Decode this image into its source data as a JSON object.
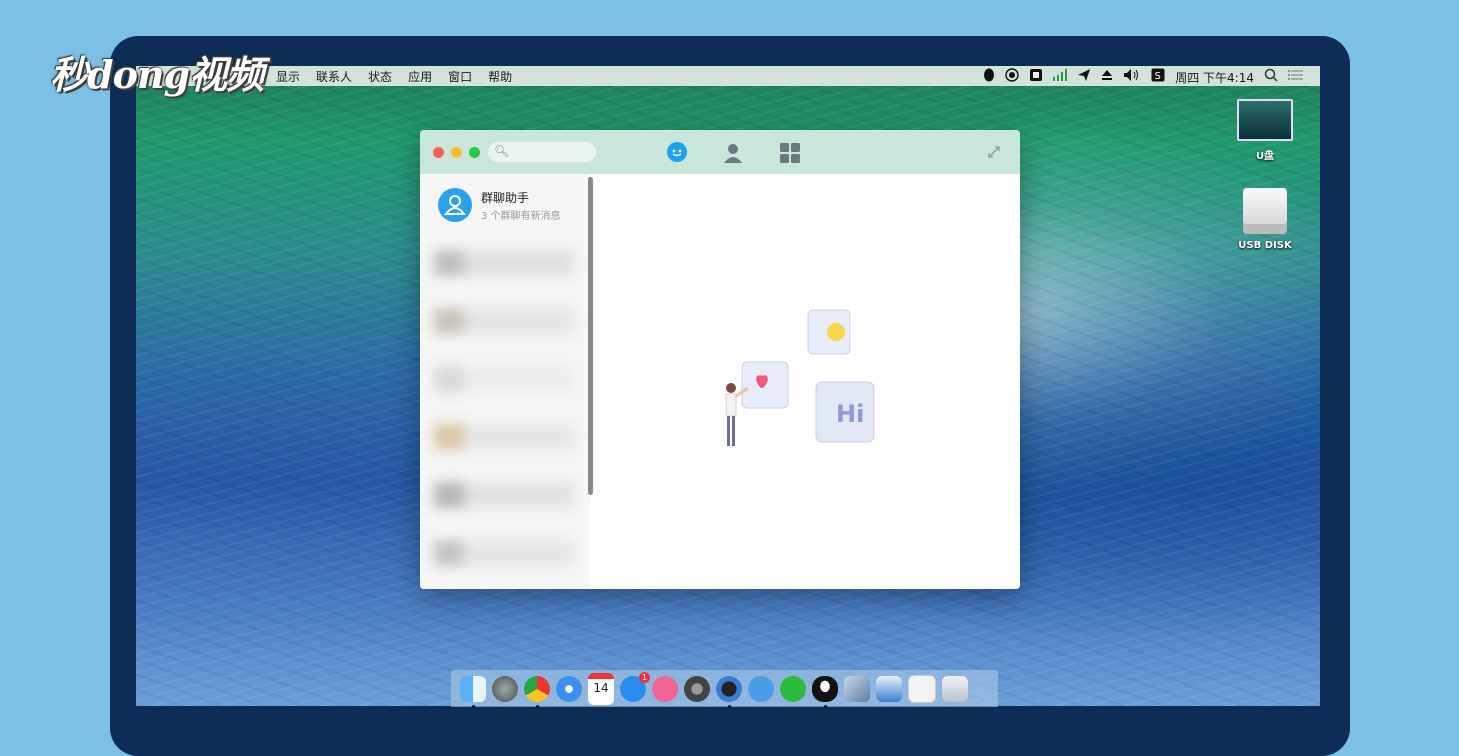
{
  "menubar": {
    "menus": [
      "式",
      "显示",
      "联系人",
      "状态",
      "应用",
      "窗口",
      "帮助"
    ],
    "clock": "周四 下午4:14",
    "status_icons": [
      "qq-penguin-icon",
      "record-icon",
      "input-method-icon",
      "signal-icon",
      "send-icon",
      "eject-icon",
      "volume-icon",
      "sogou-icon",
      "spotlight-search-icon",
      "notification-center-icon"
    ]
  },
  "watermark": {
    "text": "秒dong视频"
  },
  "desktop": {
    "icons": [
      {
        "label": "U盘"
      },
      {
        "label": "USB DISK"
      }
    ]
  },
  "qq_window": {
    "search": {
      "placeholder": ""
    },
    "tabs": [
      "messages-tab",
      "contacts-tab",
      "apps-tab"
    ],
    "conversations": [
      {
        "name": "群聊助手",
        "preview": "3 个群聊有新消息"
      }
    ],
    "illustration_text": "Hi"
  },
  "dock": {
    "apps": [
      "finder",
      "launchpad",
      "chrome",
      "safari",
      "calendar",
      "app-store",
      "paper-plane",
      "system-preferences",
      "quicktime",
      "qq-browser",
      "wechat",
      "qq",
      "virtualbox",
      "keynote",
      "documents",
      "trash"
    ],
    "calendar_day": "14",
    "app_store_badge": "1"
  }
}
